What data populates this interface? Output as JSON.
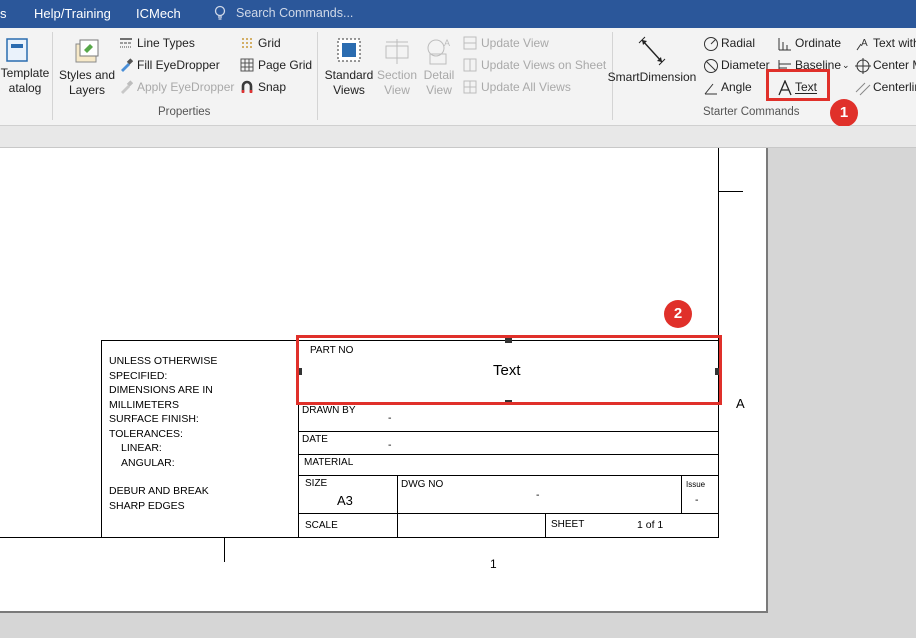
{
  "menubar": {
    "items": [
      "s",
      "Help/Training",
      "ICMech"
    ],
    "search_placeholder": "Search Commands...",
    "bg_color": "#2b579a"
  },
  "ribbon": {
    "template_catalog": {
      "line1": "Template",
      "line2": "atalog"
    },
    "styles_and_layers": {
      "line1": "Styles and",
      "line2": "Layers"
    },
    "properties": {
      "line_types": "Line Types",
      "fill_eyedropper": "Fill EyeDropper",
      "apply_eyedropper": "Apply EyeDropper",
      "grid": "Grid",
      "page_grid": "Page Grid",
      "snap": "Snap",
      "group_label": "Properties"
    },
    "views": {
      "standard": {
        "line1": "Standard",
        "line2": "Views"
      },
      "section": {
        "line1": "Section",
        "line2": "View"
      },
      "detail": {
        "line1": "Detail",
        "line2": "View"
      },
      "update_view": "Update View",
      "update_views_on_sheet": "Update Views on Sheet",
      "update_all_views": "Update All Views"
    },
    "smart_dimension": "SmartDimension",
    "starter": {
      "radial": "Radial",
      "diameter": "Diameter",
      "angle": "Angle",
      "ordinate": "Ordinate",
      "baseline": "Baseline",
      "text": "Text",
      "text_with": "Text with",
      "center_m": "Center M",
      "centerline": "Centerlin",
      "group_label": "Starter Commands"
    }
  },
  "annotations": {
    "step1": "1",
    "step2": "2",
    "highlight_color": "#e0302a"
  },
  "title_block": {
    "notes": [
      "UNLESS OTHERWISE",
      "SPECIFIED:",
      "DIMENSIONS ARE IN",
      "MILLIMETERS",
      "SURFACE FINISH:",
      "TOLERANCES:",
      "LINEAR:",
      "ANGULAR:",
      "DEBUR AND BREAK",
      "SHARP EDGES"
    ],
    "part_no_label": "PART NO",
    "part_no_value": "Text",
    "drawn_by_label": "DRAWN BY",
    "drawn_by_value": "-",
    "date_label": "DATE",
    "date_value": "-",
    "material_label": "MATERIAL",
    "size_label": "SIZE",
    "size_value": "A3",
    "dwg_no_label": "DWG  NO",
    "dwg_no_value": "-",
    "issue_label": "Issue",
    "issue_value": "-",
    "scale_label": "SCALE",
    "sheet_label": "SHEET",
    "sheet_value": "1 of 1",
    "zone_letter": "A",
    "zone_number": "1"
  }
}
